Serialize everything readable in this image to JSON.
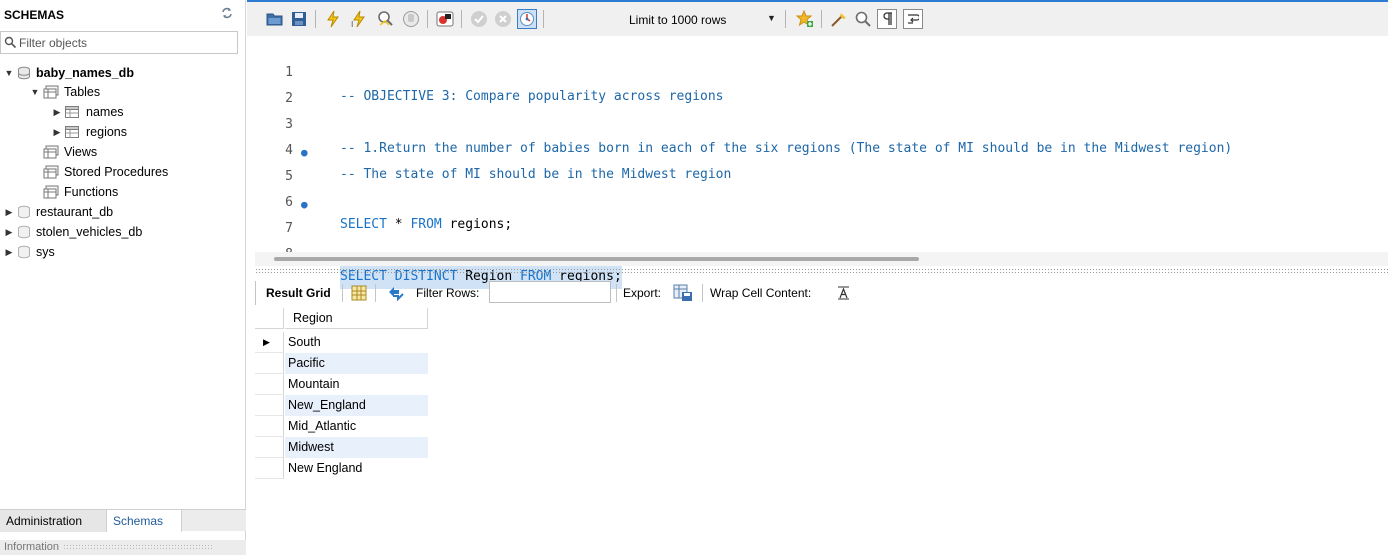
{
  "sidebar": {
    "title": "SCHEMAS",
    "filter_placeholder": "Filter objects",
    "tree": {
      "db1": "baby_names_db",
      "tables": "Tables",
      "table1": "names",
      "table2": "regions",
      "views": "Views",
      "procs": "Stored Procedures",
      "funcs": "Functions",
      "db2": "restaurant_db",
      "db3": "stolen_vehicles_db",
      "db4": "sys"
    },
    "tabs": {
      "admin": "Administration",
      "schemas": "Schemas"
    },
    "info": "Information"
  },
  "toolbar": {
    "limit": "Limit to 1000 rows",
    "icons": [
      "open-folder-icon",
      "save-icon",
      "execute-icon",
      "execute-current-icon",
      "explain-icon",
      "stop-icon",
      "toggle-error-icon",
      "commit-icon",
      "rollback-icon",
      "autocommit-icon",
      "limit-rows-select",
      "add-snippet-icon",
      "beautify-icon",
      "find-icon",
      "invisible-chars-icon",
      "word-wrap-icon"
    ]
  },
  "editor": {
    "lines": [
      {
        "n": "1",
        "t": "-- OBJECTIVE 3: Compare popularity across regions"
      },
      {
        "n": "2",
        "t": ""
      },
      {
        "n": "3",
        "t": "-- 1.Return the number of babies born in each of the six regions (The state of MI should be in the Midwest region)"
      },
      {
        "n": "4",
        "t": "-- The state of MI should be in the Midwest region"
      },
      {
        "n": "5",
        "kw1": "SELECT",
        "mid": " * ",
        "kw2": "FROM",
        "tail": " regions;"
      },
      {
        "n": "6",
        "t": ""
      },
      {
        "n": "7",
        "kw1": "SELECT DISTINCT",
        "mid": " Region ",
        "kw2": "FROM",
        "tail": " regions;"
      },
      {
        "n": "8",
        "t": ""
      }
    ]
  },
  "results": {
    "tab": "Result Grid",
    "filter_label": "Filter Rows:",
    "export_label": "Export:",
    "wrap_label": "Wrap Cell Content:",
    "column": "Region",
    "rows": [
      "South",
      "Pacific",
      "Mountain",
      "New_England",
      "Mid_Atlantic",
      "Midwest",
      "New England"
    ]
  }
}
